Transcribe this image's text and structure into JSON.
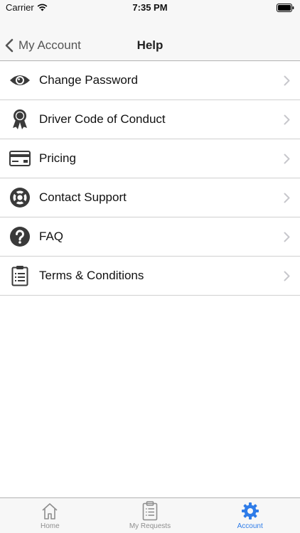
{
  "status_bar": {
    "carrier": "Carrier",
    "time": "7:35 PM"
  },
  "nav": {
    "back_label": "My Account",
    "title": "Help"
  },
  "menu": {
    "items": [
      {
        "label": "Change Password",
        "icon": "eye-icon"
      },
      {
        "label": "Driver Code of Conduct",
        "icon": "award-ribbon-icon"
      },
      {
        "label": "Pricing",
        "icon": "credit-card-icon"
      },
      {
        "label": "Contact Support",
        "icon": "lifebuoy-icon"
      },
      {
        "label": "FAQ",
        "icon": "question-circle-icon"
      },
      {
        "label": "Terms & Conditions",
        "icon": "clipboard-icon"
      }
    ]
  },
  "tab_bar": {
    "tabs": [
      {
        "label": "Home",
        "icon": "home-icon",
        "active": false
      },
      {
        "label": "My Requests",
        "icon": "clipboard-icon",
        "active": false
      },
      {
        "label": "Account",
        "icon": "gear-icon",
        "active": true
      }
    ]
  },
  "colors": {
    "accent": "#2f7ce8",
    "icon_dark": "#3a3a3a",
    "chevron": "#c7c7cc",
    "bar_bg": "#f7f7f7"
  }
}
